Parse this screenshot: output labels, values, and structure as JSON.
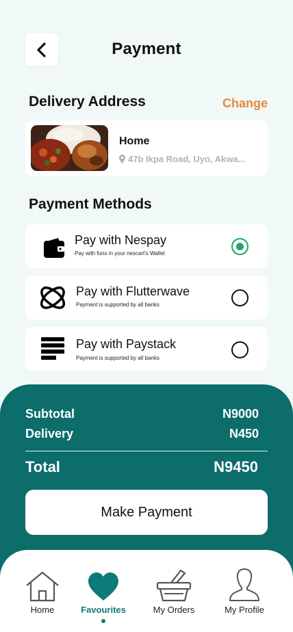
{
  "header": {
    "title": "Payment"
  },
  "delivery": {
    "heading": "Delivery Address",
    "change_label": "Change",
    "name": "Home",
    "address": "47b Ikpa Road, Uyo, Akwa..."
  },
  "payment": {
    "heading": "Payment Methods",
    "methods": [
      {
        "title": "Pay with Nespay",
        "subtitle": "Pay with funs in your nescart's Wallet",
        "icon": "wallet-icon",
        "selected": true
      },
      {
        "title": "Pay with Flutterwave",
        "subtitle": "Payment is supported by all banks",
        "icon": "flutterwave-icon",
        "selected": false
      },
      {
        "title": "Pay with Paystack",
        "subtitle": "Payment is supported by all banks",
        "icon": "paystack-icon",
        "selected": false
      }
    ]
  },
  "summary": {
    "subtotal_label": "Subtotal",
    "subtotal_value": "N9000",
    "delivery_label": "Delivery",
    "delivery_value": "N450",
    "total_label": "Total",
    "total_value": "N9450",
    "button_label": "Make Payment"
  },
  "nav": {
    "items": [
      {
        "label": "Home",
        "icon": "home-icon",
        "active": false
      },
      {
        "label": "Favourites",
        "icon": "heart-icon",
        "active": true
      },
      {
        "label": "My Orders",
        "icon": "basket-icon",
        "active": false
      },
      {
        "label": "My Profile",
        "icon": "profile-icon",
        "active": false
      }
    ]
  },
  "colors": {
    "primary": "#0c6d6b",
    "accent": "#e58a3a",
    "selected": "#24a26a",
    "background": "#f1f8f8"
  }
}
